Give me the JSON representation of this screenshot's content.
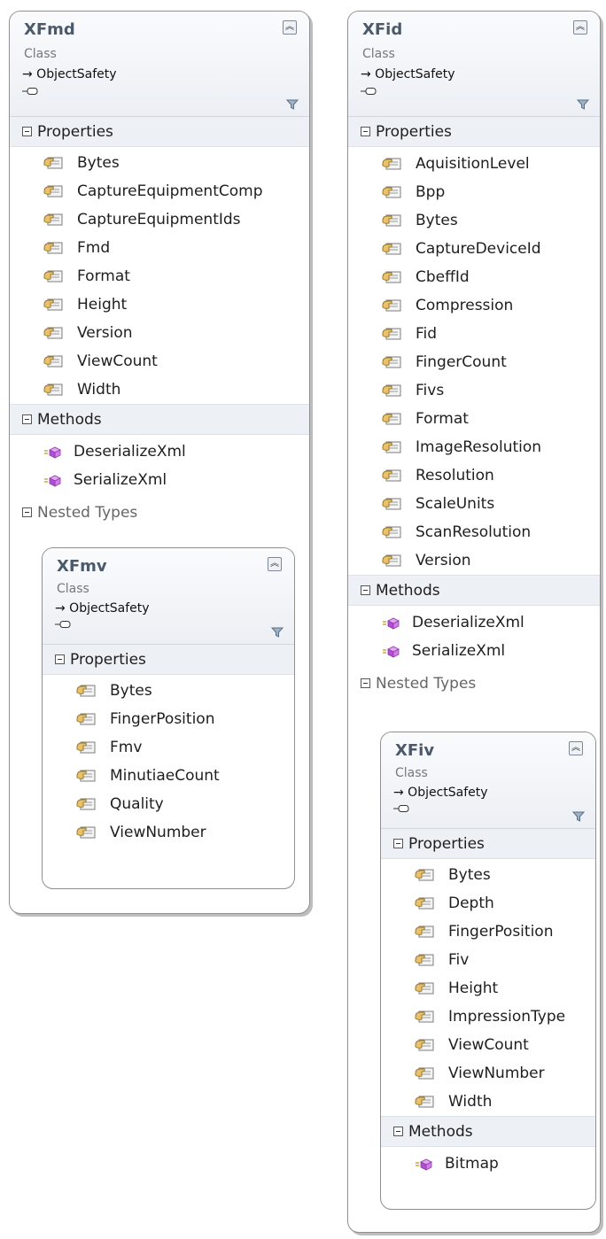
{
  "xfmd": {
    "name": "XFmd",
    "kind": "Class",
    "inherits": "→ ObjectSafety",
    "properties_label": "Properties",
    "properties": [
      "Bytes",
      "CaptureEquipmentComp",
      "CaptureEquipmentIds",
      "Fmd",
      "Format",
      "Height",
      "Version",
      "ViewCount",
      "Width"
    ],
    "methods_label": "Methods",
    "methods": [
      "DeserializeXml",
      "SerializeXml"
    ],
    "nested_label": "Nested Types",
    "nested": {
      "name": "XFmv",
      "kind": "Class",
      "inherits": "→ ObjectSafety",
      "properties_label": "Properties",
      "properties": [
        "Bytes",
        "FingerPosition",
        "Fmv",
        "MinutiaeCount",
        "Quality",
        "ViewNumber"
      ]
    }
  },
  "xfid": {
    "name": "XFid",
    "kind": "Class",
    "inherits": "→ ObjectSafety",
    "properties_label": "Properties",
    "properties": [
      "AquisitionLevel",
      "Bpp",
      "Bytes",
      "CaptureDeviceId",
      "CbeffId",
      "Compression",
      "Fid",
      "FingerCount",
      "Fivs",
      "Format",
      "ImageResolution",
      "Resolution",
      "ScaleUnits",
      "ScanResolution",
      "Version"
    ],
    "methods_label": "Methods",
    "methods": [
      "DeserializeXml",
      "SerializeXml"
    ],
    "nested_label": "Nested Types",
    "nested": {
      "name": "XFiv",
      "kind": "Class",
      "inherits": "→ ObjectSafety",
      "properties_label": "Properties",
      "properties": [
        "Bytes",
        "Depth",
        "FingerPosition",
        "Fiv",
        "Height",
        "ImpressionType",
        "ViewCount",
        "ViewNumber",
        "Width"
      ],
      "methods_label": "Methods",
      "methods": [
        "Bitmap"
      ]
    }
  }
}
